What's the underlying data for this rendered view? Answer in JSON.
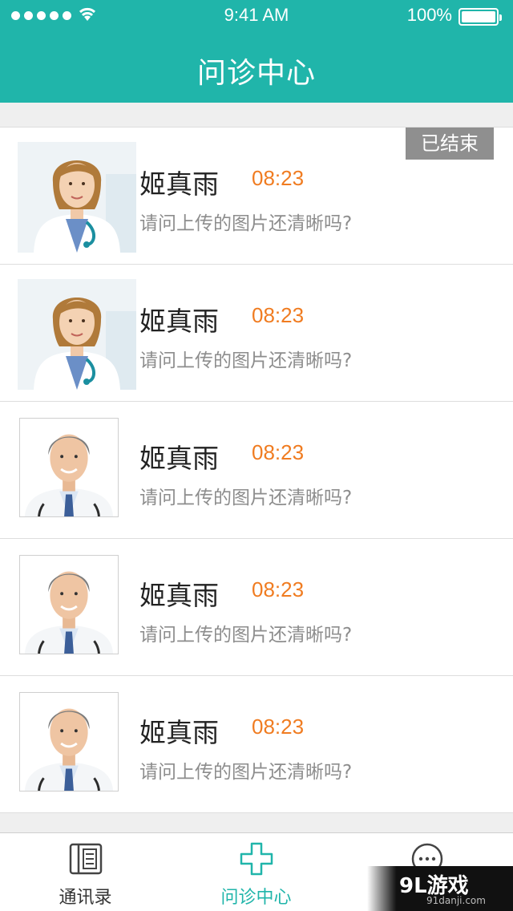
{
  "status_bar": {
    "time": "9:41 AM",
    "battery": "100%"
  },
  "header": {
    "title": "问诊中心"
  },
  "consultations": [
    {
      "avatar": "female-doctor",
      "name": "姬真雨",
      "time": "08:23",
      "message": "请问上传的图片还清晰吗?",
      "badge": "已结束"
    },
    {
      "avatar": "female-doctor",
      "name": "姬真雨",
      "time": "08:23",
      "message": "请问上传的图片还清晰吗?"
    },
    {
      "avatar": "male-doctor",
      "name": "姬真雨",
      "time": "08:23",
      "message": "请问上传的图片还清晰吗?"
    },
    {
      "avatar": "male-doctor",
      "name": "姬真雨",
      "time": "08:23",
      "message": "请问上传的图片还清晰吗?"
    },
    {
      "avatar": "male-doctor",
      "name": "姬真雨",
      "time": "08:23",
      "message": "请问上传的图片还清晰吗?"
    }
  ],
  "tabbar": {
    "tabs": [
      {
        "label": "通讯录",
        "icon": "contacts-icon"
      },
      {
        "label": "问诊中心",
        "icon": "plus-cross-icon",
        "active": true
      },
      {
        "label": "",
        "icon": "chat-bubble-icon"
      }
    ]
  },
  "watermark": {
    "main": "9L游戏",
    "sub": "91danji.com"
  },
  "colors": {
    "accent": "#20b5aa",
    "time": "#f07c21",
    "badge": "#8f8f8f"
  }
}
